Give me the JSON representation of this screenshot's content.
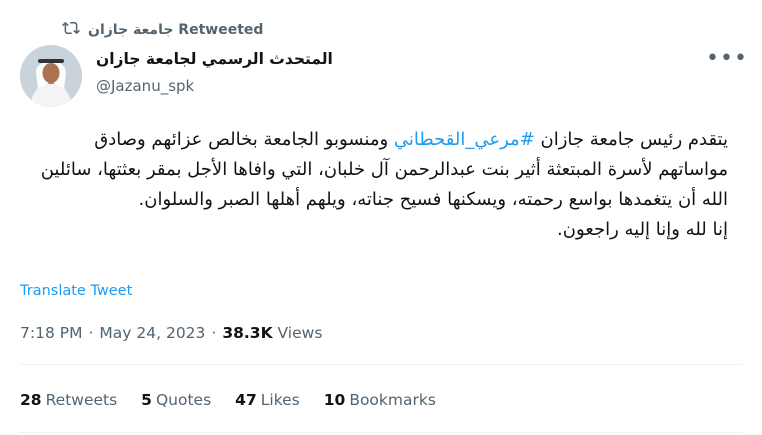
{
  "retweet": {
    "label": "جامعة جازان Retweeted",
    "icon": "retweet-icon"
  },
  "author": {
    "name": "المتحدث الرسمي لجامعة جازان",
    "handle": "@Jazanu_spk",
    "avatar": "avatar-photo"
  },
  "tweet": {
    "part1": "يتقدم رئيس جامعة جازان ",
    "hashtag": "#مرعي_القحطاني",
    "part2": " ومنسوبو الجامعة بخالص عزائهم وصادق مواساتهم لأسرة المبتعثة أثير بنت عبدالرحمن آل خلبان، التي وافاها الأجل بمقر بعثتها، سائلين الله أن يتغمدها بواسع رحمته، ويسكنها فسيح جناته، ويلهم أهلها الصبر والسلوان.",
    "line2": "إنا لله وإنا إليه راجعون."
  },
  "translate_label": "Translate Tweet",
  "meta": {
    "time": "7:18 PM",
    "sep1": "·",
    "date": "May 24, 2023",
    "sep2": "·",
    "views_count": "38.3K",
    "views_label": "Views"
  },
  "stats": {
    "retweets_count": "28",
    "retweets_label": "Retweets",
    "quotes_count": "5",
    "quotes_label": "Quotes",
    "likes_count": "47",
    "likes_label": "Likes",
    "bookmarks_count": "10",
    "bookmarks_label": "Bookmarks"
  },
  "more_label": "•••",
  "colors": {
    "accent": "#1d9bf0",
    "secondary_text": "#536471",
    "primary_text": "#0f1419"
  }
}
